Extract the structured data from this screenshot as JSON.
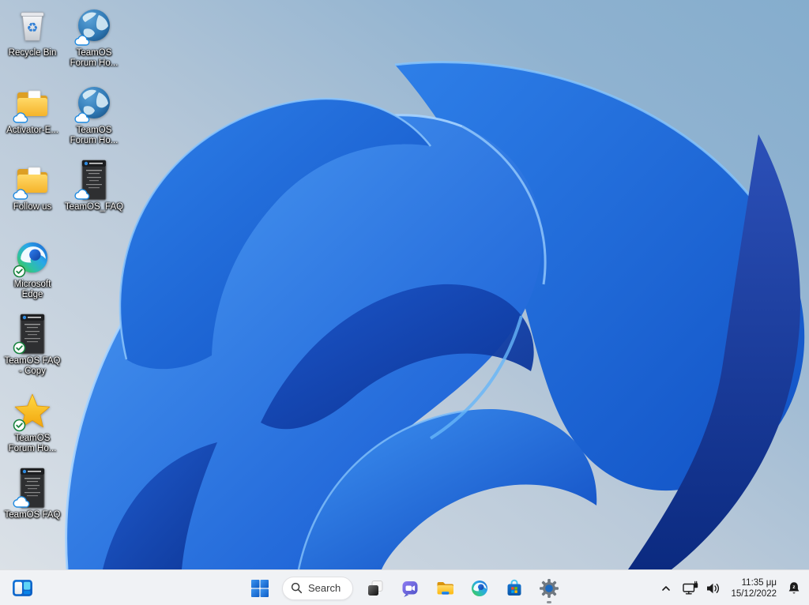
{
  "desktop": {
    "icons": [
      {
        "label": "Recycle Bin",
        "type": "recycle-bin",
        "overlay": "none"
      },
      {
        "label": "TeamOS Forum Ho...",
        "type": "globe-shortcut",
        "overlay": "cloud"
      },
      {
        "label": "Activator-E...",
        "type": "folder",
        "overlay": "cloud"
      },
      {
        "label": "TeamOS Forum Ho...",
        "type": "globe-shortcut",
        "overlay": "cloud"
      },
      {
        "label": "Follow us",
        "type": "folder",
        "overlay": "cloud"
      },
      {
        "label": "TeamOS_FAQ",
        "type": "text-document",
        "overlay": "cloud"
      },
      {
        "label": "Microsoft Edge",
        "type": "edge-browser",
        "overlay": "check"
      },
      {
        "label": "TeamOS FAQ - Copy",
        "type": "text-document",
        "overlay": "check"
      },
      {
        "label": "TeamOS Forum Ho...",
        "type": "star-shortcut",
        "overlay": "check"
      },
      {
        "label": "TeamOS FAQ",
        "type": "text-document",
        "overlay": "cloud"
      }
    ]
  },
  "taskbar": {
    "search": {
      "label": "Search"
    },
    "pinned_icons": [
      "widgets",
      "start",
      "search",
      "task-view",
      "chat",
      "file-explorer",
      "edge",
      "store",
      "settings"
    ],
    "settings_running": true
  },
  "tray": {
    "time": "11:35 μμ",
    "date": "15/12/2022",
    "icons": [
      "hidden-icons-chevron",
      "network",
      "volume",
      "notification-bell-dnd"
    ]
  },
  "colors": {
    "taskbar_bg": "#f0f2f5",
    "wallpaper_bright_blue": "#2f86f0",
    "wallpaper_deep_blue": "#0a2f8f",
    "wallpaper_bg_top_right": "#85adcd",
    "wallpaper_bg_bottom_left": "#dbe1e7",
    "accent_blue": "#1572d8",
    "check_green": "#18833f",
    "cloud_blue": "#1f8ae0"
  }
}
